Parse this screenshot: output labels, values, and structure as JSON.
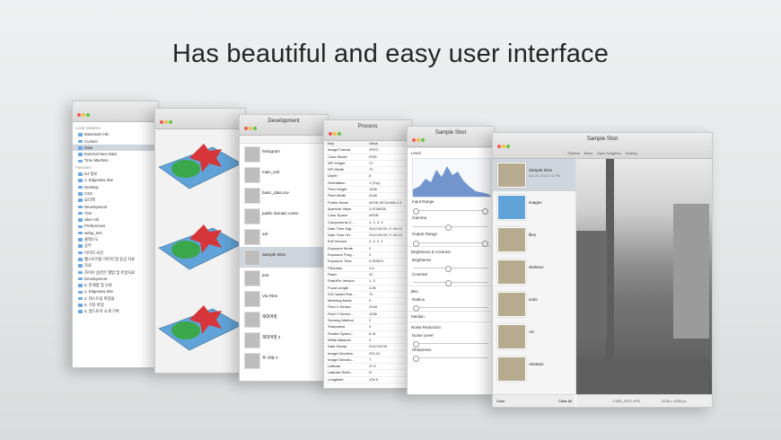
{
  "headline": "Has beautiful and easy user interface",
  "win1": {
    "title": "",
    "sidebar": [
      {
        "label": "Local Volumes",
        "sec": true
      },
      {
        "label": "Macintosh HD"
      },
      {
        "label": "Custom"
      },
      {
        "label": "Data",
        "sel": true
      },
      {
        "label": "External New Data"
      },
      {
        "label": "Time Machine"
      },
      {
        "label": "Favorites",
        "sec": true
      },
      {
        "label": "DJ 정보"
      },
      {
        "label": "1. Edgeview Site"
      },
      {
        "label": "Desktop"
      },
      {
        "label": "CSS"
      },
      {
        "label": "요리책"
      },
      {
        "label": "Development"
      },
      {
        "label": "Tistr"
      },
      {
        "label": "viker-roll"
      },
      {
        "label": "Preferences"
      },
      {
        "label": "webp_test"
      },
      {
        "label": "클래스도"
      },
      {
        "label": "공부"
      },
      {
        "label": "이미지 사진"
      },
      {
        "label": "웹스토어용 이미지 및 동상 자료"
      },
      {
        "label": "자료"
      },
      {
        "label": "하이브 음반은 앨범 및 쥬얼자료"
      },
      {
        "label": "Development"
      },
      {
        "label": "0. 문제점 및 오류"
      },
      {
        "label": "1. Edgeview Site"
      },
      {
        "label": "2. 테스트용 파일들"
      },
      {
        "label": "3. 기타 파일"
      },
      {
        "label": "4. 앱스토어 소개 기록"
      }
    ]
  },
  "win2": {
    "title": ""
  },
  "win3": {
    "title": "Development",
    "items": [
      {
        "name": "histogram"
      },
      {
        "name": "main_exit"
      },
      {
        "name": "basic_data.csv"
      },
      {
        "name": "public domain comic"
      },
      {
        "name": "saf"
      },
      {
        "name": "Sample Shot",
        "sel": true
      },
      {
        "name": "test"
      },
      {
        "name": "Via Files"
      },
      {
        "name": "해외여행"
      },
      {
        "name": "해외여행 2"
      },
      {
        "name": "추-서류 #"
      }
    ]
  },
  "win4": {
    "title": "Process",
    "header": [
      "Key",
      "Value"
    ],
    "rows": [
      [
        "Image Format",
        "JPEG"
      ],
      [
        "Color Model",
        "RGB"
      ],
      [
        "DPI Height",
        "72"
      ],
      [
        "DPI Width",
        "72"
      ],
      [
        "Depth",
        "8"
      ],
      [
        "Orientation",
        "1 (Top)"
      ],
      [
        "Pixel Height",
        "1536"
      ],
      [
        "Pixel Width",
        "2048"
      ],
      [
        "Profile Name",
        "sRGB IEC61966-2.1"
      ],
      [
        "Aperture Value",
        "2.9708536"
      ],
      [
        "Color Space",
        "sRGB"
      ],
      [
        "Components C...",
        "1, 2, 3, 0"
      ],
      [
        "Date Time Digi...",
        "2012:05:09 17:16:13"
      ],
      [
        "Date Time Ori...",
        "2012:05:09 17:16:13"
      ],
      [
        "Exif Version",
        "2, 2, 2, 1"
      ],
      [
        "Exposure Mode",
        "0"
      ],
      [
        "Exposure Prog...",
        "2"
      ],
      [
        "Exposure Time",
        "0.003021"
      ],
      [
        "FNumber",
        "2.8"
      ],
      [
        "Flash",
        "32"
      ],
      [
        "FlashPix Version",
        "1, 0"
      ],
      [
        "Focal Length",
        "3.85"
      ],
      [
        "ISO Speed Rat...",
        "70"
      ],
      [
        "Metering Mode",
        "5"
      ],
      [
        "Pixel X Dimen...",
        "2048"
      ],
      [
        "Pixel Y Dimen...",
        "1536"
      ],
      [
        "Sensing Method",
        "2"
      ],
      [
        "Sharpness",
        "0"
      ],
      [
        "Shutter Speed...",
        "8.31"
      ],
      [
        "White Balance",
        "0"
      ],
      [
        "Date Stamp",
        "2012:05:09"
      ],
      [
        "Image Direction",
        "220.10"
      ],
      [
        "Image Directio...",
        "T"
      ],
      [
        "Latitude",
        "37.5"
      ],
      [
        "Latitude Refer...",
        "N"
      ],
      [
        "Longitude",
        "126.9"
      ]
    ]
  },
  "win5": {
    "title": "Sample Shot",
    "sections": {
      "level": "Level",
      "input_range": "Input Range",
      "gamma": "Gamma",
      "output_range": "Output Range",
      "black": "Black",
      "white": "White",
      "brightness_contrast": "Brightness & Contrast",
      "brightness": "Brightness",
      "contrast": "Contrast",
      "blur": "Blur",
      "radius": "Radius",
      "median": "Median",
      "noise_reduction": "Noise Reduction",
      "noise_level": "Noise Level",
      "sharpness": "Sharpness"
    }
  },
  "win6": {
    "title": "Sample Shot",
    "toolbar": [
      "Sidebar",
      "Move",
      "Open Neighbor",
      "Scaling"
    ],
    "thumbs": [
      {
        "name": "Sample Shot",
        "sub": "Dec 20, 2013 1:41 PM",
        "sel": true
      },
      {
        "name": "images",
        "sub": ""
      },
      {
        "name": "files",
        "sub": ""
      },
      {
        "name": "skeleton",
        "sub": ""
      },
      {
        "name": "tools",
        "sub": ""
      },
      {
        "name": "Art",
        "sub": ""
      },
      {
        "name": "Abstract",
        "sub": ""
      }
    ],
    "footer_left": "Color",
    "footer_right": "Clear All",
    "status": "1 IMG_0371.JPG",
    "status2": "2048 x 1536 px"
  },
  "colors": {
    "accent": "#3b82d8",
    "selection": "#cfd5dd"
  }
}
